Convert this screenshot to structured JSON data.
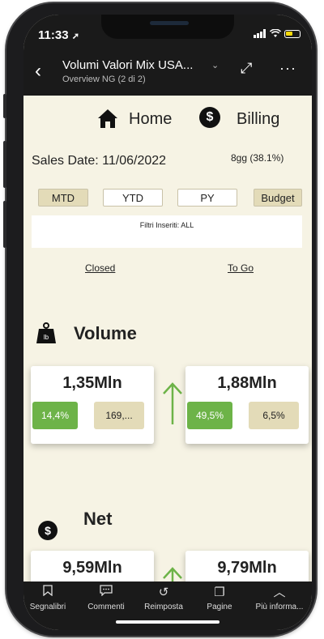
{
  "status": {
    "time": "11:33",
    "location_icon": "location-arrow-icon"
  },
  "header": {
    "title": "Volumi Valori Mix USA...",
    "subtitle": "Overview NG (2 di 2)"
  },
  "nav": {
    "home": "Home",
    "billing": "Billing",
    "billing_icon_glyph": "$"
  },
  "sales": {
    "date_label": "Sales Date: 11/06/2022",
    "gg": "8gg (38.1%)"
  },
  "tabs": [
    {
      "label": "MTD",
      "active": true
    },
    {
      "label": "YTD",
      "active": false
    },
    {
      "label": "PY",
      "active": false
    },
    {
      "label": "Budget",
      "active": true
    }
  ],
  "filter": {
    "text": "Filtri Inseriti: ALL"
  },
  "links": {
    "closed": "Closed",
    "togo": "To Go"
  },
  "volume": {
    "title": "Volume",
    "icon_glyph": "lb",
    "left": {
      "value": "1,35Mln",
      "pill1": "14,4%",
      "pill2": "169,..."
    },
    "right": {
      "value": "1,88Mln",
      "pill1": "49,5%",
      "pill2": "6,5%"
    }
  },
  "net": {
    "title": "Net",
    "icon_glyph": "$",
    "left": {
      "value": "9,59Mln"
    },
    "right": {
      "value": "9,79Mln"
    }
  },
  "bottom_nav": [
    {
      "label": "Segnalibri",
      "icon": "bookmark-icon",
      "glyph": "▯"
    },
    {
      "label": "Commenti",
      "icon": "comment-icon",
      "glyph": "💬"
    },
    {
      "label": "Reimposta",
      "icon": "reset-icon",
      "glyph": "↺"
    },
    {
      "label": "Pagine",
      "icon": "pages-icon",
      "glyph": "❐"
    },
    {
      "label": "Più informa...",
      "icon": "chevron-up-icon",
      "glyph": "︿"
    }
  ],
  "colors": {
    "accent_green": "#6db348",
    "beige": "#e3dbb8",
    "background": "#f6f3e4",
    "bar": "#1a1a1a"
  }
}
